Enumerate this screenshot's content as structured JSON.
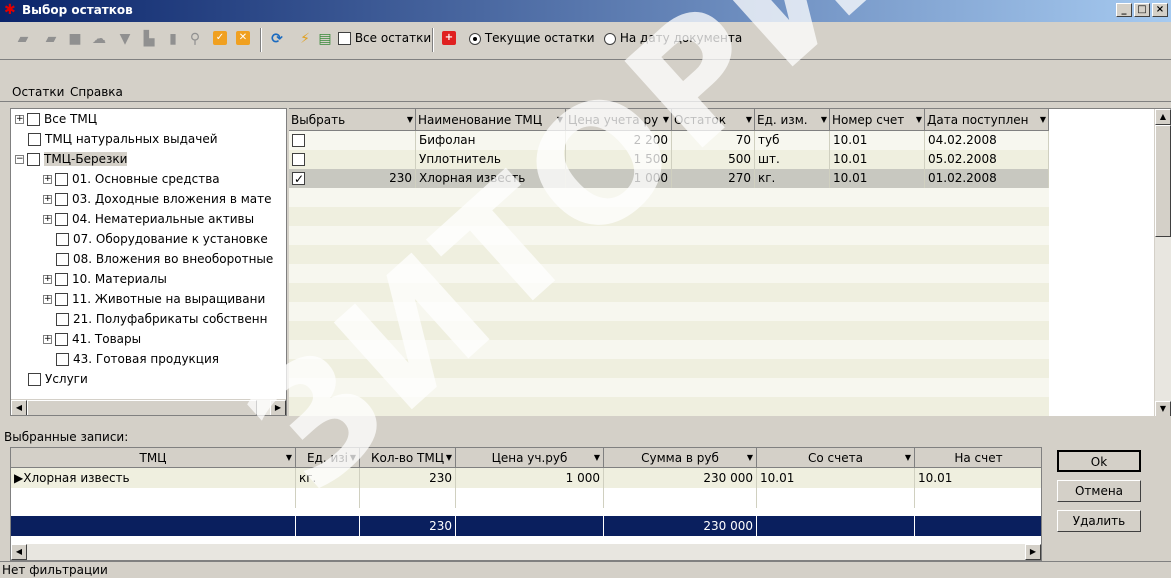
{
  "window": {
    "title": "Выбор остатков",
    "controls": [
      "_",
      "□",
      "×"
    ]
  },
  "toolbar": {
    "all_remains_label": "Все остатки",
    "all_remains_checked": false,
    "radio_current_label": "Текущие остатки",
    "radio_date_label": "На дату документа",
    "selected_radio": "current"
  },
  "menu": {
    "items": [
      "Остатки",
      "Справка"
    ]
  },
  "tree": {
    "nodes": [
      {
        "label": "Все ТМЦ",
        "expander": "+",
        "level": 0
      },
      {
        "label": "ТМЦ натуральных выдачей",
        "expander": "",
        "level": 0
      },
      {
        "label": "ТМЦ-Березки",
        "expander": "-",
        "level": 0,
        "highlight": true
      },
      {
        "label": "01. Основные средства",
        "expander": "+",
        "level": 1
      },
      {
        "label": "03. Доходные вложения в мате",
        "expander": "+",
        "level": 1
      },
      {
        "label": "04. Нематериальные активы",
        "expander": "+",
        "level": 1
      },
      {
        "label": "07. Оборудование к установке",
        "expander": "",
        "level": 1
      },
      {
        "label": "08. Вложения во внеоборотные",
        "expander": "",
        "level": 1
      },
      {
        "label": "10. Материалы",
        "expander": "+",
        "level": 1
      },
      {
        "label": "11. Животные на выращивани",
        "expander": "+",
        "level": 1
      },
      {
        "label": "21. Полуфабрикаты собственн",
        "expander": "",
        "level": 1
      },
      {
        "label": "41. Товары",
        "expander": "+",
        "level": 1
      },
      {
        "label": "43. Готовая продукция",
        "expander": "",
        "level": 1
      },
      {
        "label": "Услуги",
        "expander": "",
        "level": 0
      }
    ]
  },
  "grid": {
    "columns": [
      "Выбрать",
      "Наименование ТМЦ",
      "Цена учета ру",
      "Остаток",
      "Ед. изм.",
      "Номер счет",
      "Дата поступлен"
    ],
    "rows": [
      {
        "checked": false,
        "qty": "",
        "name": "Бифолан",
        "price": "2 200",
        "rest": "70",
        "unit": "туб",
        "account": "10.01",
        "date": "04.02.2008"
      },
      {
        "checked": false,
        "qty": "",
        "name": "Уплотнитель",
        "price": "1 500",
        "rest": "500",
        "unit": "шт.",
        "account": "10.01",
        "date": "05.02.2008"
      },
      {
        "checked": true,
        "qty": "230",
        "name": "Хлорная известь",
        "price": "1 000",
        "rest": "270",
        "unit": "кг.",
        "account": "10.01",
        "date": "01.02.2008"
      }
    ]
  },
  "selected": {
    "label": "Выбранные записи:",
    "columns": [
      "ТМЦ",
      "Ед. изі",
      "Кол-во ТМЦ",
      "Цена уч.руб",
      "Сумма в руб",
      "Со счета",
      "На счет"
    ],
    "rows": [
      {
        "name": "Хлорная известь",
        "unit": "кг.",
        "qty": "230",
        "price": "1 000",
        "sum": "230 000",
        "from": "10.01",
        "to": "10.01"
      }
    ],
    "totals": {
      "qty": "230",
      "sum": "230 000"
    }
  },
  "buttons": {
    "ok": "Ok",
    "cancel": "Отмена",
    "delete": "Удалить"
  },
  "status": {
    "text": "Нет фильтрации"
  },
  "watermark": "ЗИТОРИЙ"
}
